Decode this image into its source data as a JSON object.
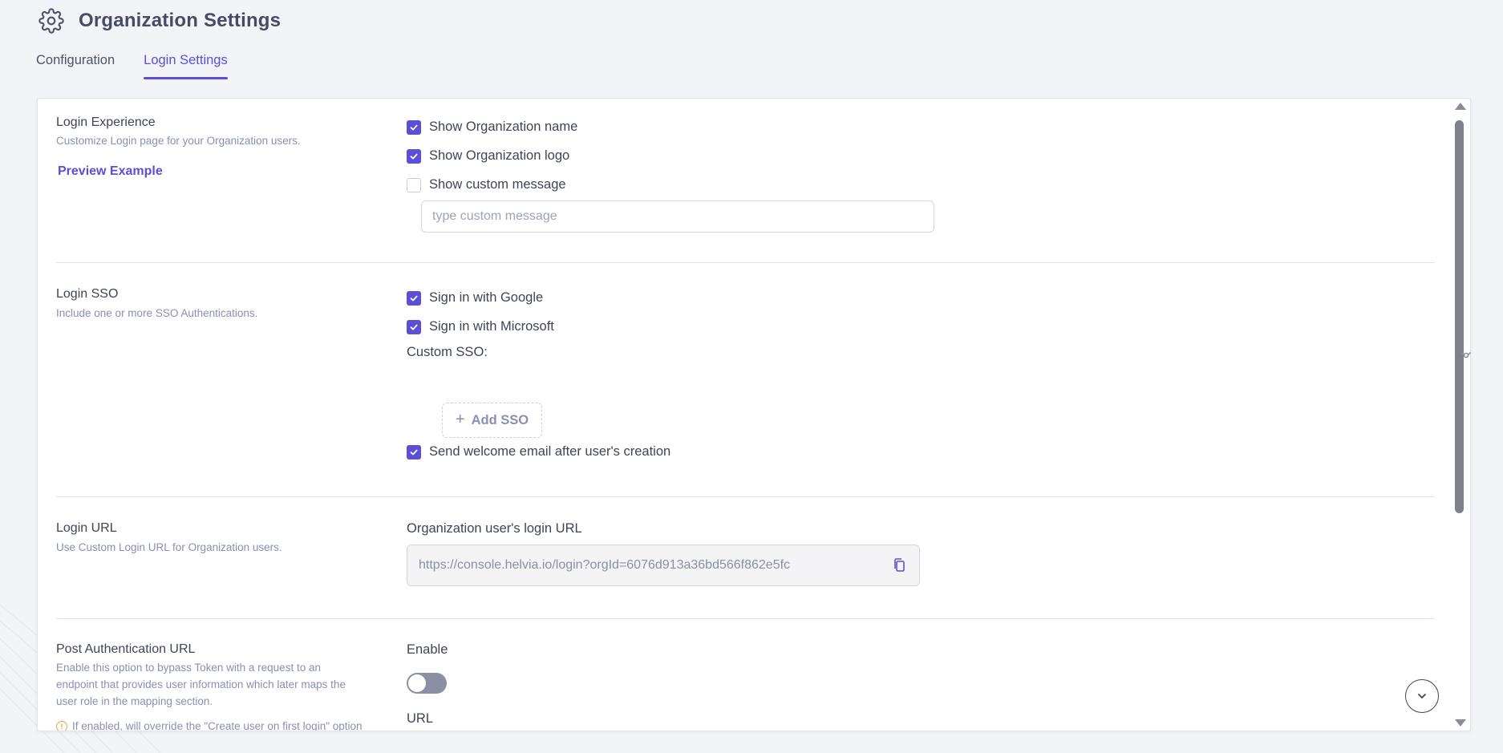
{
  "header": {
    "title": "Organization Settings",
    "icon": "gear-icon"
  },
  "tabs": [
    {
      "label": "Configuration",
      "active": false
    },
    {
      "label": "Login Settings",
      "active": true
    }
  ],
  "login_experience": {
    "title": "Login Experience",
    "description": "Customize Login page for your Organization users.",
    "preview_link": "Preview Example",
    "options": [
      {
        "label": "Show Organization name",
        "checked": true
      },
      {
        "label": "Show Organization logo",
        "checked": true
      },
      {
        "label": "Show custom message",
        "checked": false
      }
    ],
    "custom_message_placeholder": "type custom message"
  },
  "login_sso": {
    "title": "Login SSO",
    "description": "Include one or more SSO Authentications.",
    "options": [
      {
        "label": "Sign in with Google",
        "checked": true
      },
      {
        "label": "Sign in with Microsoft",
        "checked": true
      }
    ],
    "custom_sso_label": "Custom SSO:",
    "add_sso_label": "Add SSO",
    "welcome_email": {
      "label": "Send welcome email after user's creation",
      "checked": true
    }
  },
  "login_url": {
    "title": "Login URL",
    "description": "Use Custom Login URL for Organization users.",
    "field_label": "Organization user's login URL",
    "url": "https://console.helvia.io/login?orgId=6076d913a36bd566f862e5fc"
  },
  "post_auth": {
    "title": "Post Authentication URL",
    "description_lines": [
      "Enable this option to bypass Token with a request to an",
      "endpoint that provides user information which later maps the",
      "user role in the mapping section."
    ],
    "warning": "If enabled, will override the \"Create user on first login\" option",
    "enable_label": "Enable",
    "enabled": false,
    "url_label": "URL"
  },
  "colors": {
    "accent": "#5a4fd6",
    "text": "#3f4458",
    "muted": "#8a8fb5",
    "toggle_off": "#8b8fa3"
  }
}
